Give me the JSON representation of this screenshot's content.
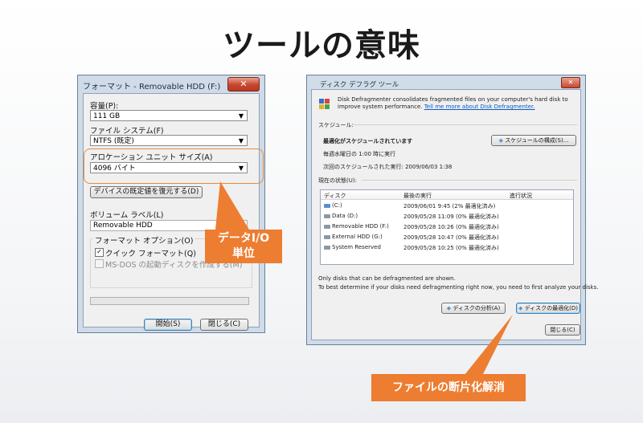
{
  "slide": {
    "title": "ツールの意味"
  },
  "format_dialog": {
    "title": "フォーマット - Removable HDD (F:)",
    "close": "✕",
    "capacity_label": "容量(P):",
    "capacity_value": "111 GB",
    "filesystem_label": "ファイル システム(F)",
    "filesystem_value": "NTFS (既定)",
    "alloc_label": "アロケーション ユニット サイズ(A)",
    "alloc_value": "4096 バイト",
    "restore_button": "デバイスの既定値を復元する(D)",
    "volume_label": "ボリューム ラベル(L)",
    "volume_value": "Removable HDD",
    "options_label": "フォーマット オプション(O)",
    "quick_format": "クイック フォーマット(Q)",
    "msdos_disk": "MS-DOS の起動ディスクを作成する(M)",
    "start_button": "開始(S)",
    "close_button": "閉じる(C)"
  },
  "callouts": {
    "data_io_line1": "データI/O",
    "data_io_line2": "単位",
    "defrag": "ファイルの断片化解消"
  },
  "defrag_dialog": {
    "title": "ディスク デフラグ ツール",
    "close": "✕",
    "description": "Disk Defragmenter consolidates fragmented files on your computer's hard disk to improve system performance.",
    "link": "Tell me more about Disk Defragmenter.",
    "schedule_header": "スケジュール:",
    "schedule_status": "最適化がスケジュールされています",
    "schedule_time": "毎週水曜日の 1:00 時に実行",
    "next_run": "次回のスケジュールされた実行: 2009/06/03 1:38",
    "configure_button": "スケジュールの構成(S)...",
    "current_status_header": "現在の状態(U):",
    "columns": [
      "ディスク",
      "最後の実行",
      "進行状況"
    ],
    "rows": [
      {
        "disk": "(C:)",
        "last_run": "2009/06/01 9:45 (2% 最適化済み)",
        "progress": ""
      },
      {
        "disk": "Data (D:)",
        "last_run": "2009/05/28 11:09 (0% 最適化済み)",
        "progress": ""
      },
      {
        "disk": "Removable HDD (F:)",
        "last_run": "2009/05/28 10:26 (0% 最適化済み)",
        "progress": ""
      },
      {
        "disk": "External HDD (G:)",
        "last_run": "2009/05/28 10:47 (0% 最適化済み)",
        "progress": ""
      },
      {
        "disk": "System Reserved",
        "last_run": "2009/05/28 10:25 (0% 最適化済み)",
        "progress": ""
      }
    ],
    "note1": "Only disks that can be defragmented are shown.",
    "note2": "To best determine if your disks need defragmenting right now, you need to first analyze your disks.",
    "analyze_button": "ディスクの分析(A)",
    "defrag_button": "ディスクの最適化(D)",
    "close_button": "閉じる(C)"
  }
}
